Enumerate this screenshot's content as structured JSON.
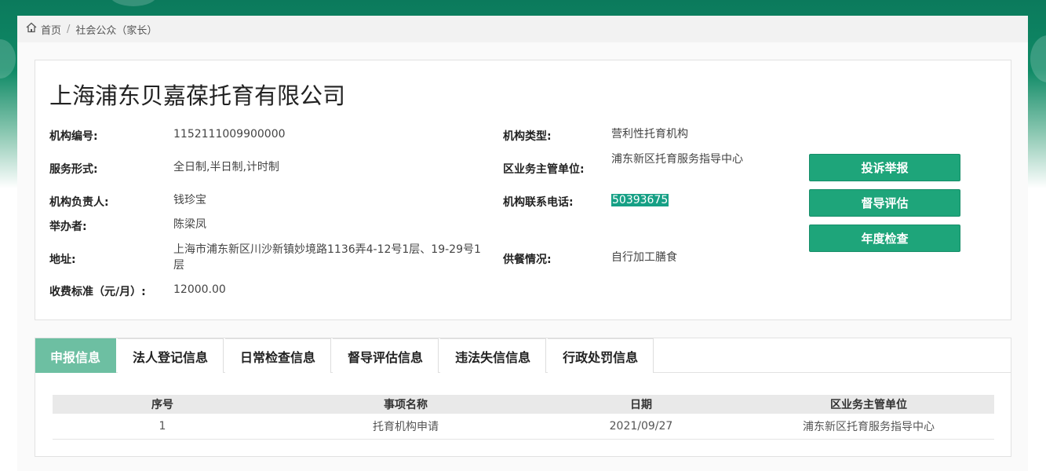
{
  "breadcrumb": {
    "home": "首页",
    "separator": "/",
    "current": "社会公众（家长）"
  },
  "org": {
    "name": "上海浦东贝嘉葆托育有限公司",
    "fields_left": [
      {
        "label": "机构编号:",
        "value": "1152111009900000"
      },
      {
        "label": "服务形式:",
        "value": "全日制,半日制,计时制"
      },
      {
        "label": "机构负责人:",
        "value": "钱珍宝"
      },
      {
        "label": "举办者:",
        "value": "陈梁凤"
      },
      {
        "label": "地址:",
        "value": "上海市浦东新区川沙新镇妙境路1136弄4-12号1层、19-29号1层"
      },
      {
        "label": "收费标准（元/月）:",
        "value": "12000.00"
      }
    ],
    "fields_right": [
      {
        "label": "机构类型:",
        "value": "营利性托育机构"
      },
      {
        "label": "区业务主管单位:",
        "value": "浦东新区托育服务指导中心"
      },
      {
        "label": "机构联系电话:",
        "value": "50393675"
      },
      {
        "label": "供餐情况:",
        "value": "自行加工膳食"
      }
    ]
  },
  "actions": {
    "complaint": "投诉举报",
    "supervision": "督导评估",
    "annual": "年度检查"
  },
  "tabs": [
    {
      "label": "申报信息",
      "active": true
    },
    {
      "label": "法人登记信息",
      "active": false
    },
    {
      "label": "日常检查信息",
      "active": false
    },
    {
      "label": "督导评估信息",
      "active": false
    },
    {
      "label": "违法失信信息",
      "active": false
    },
    {
      "label": "行政处罚信息",
      "active": false
    }
  ],
  "table": {
    "headers": [
      "序号",
      "事项名称",
      "日期",
      "区业务主管单位"
    ],
    "rows": [
      [
        "1",
        "托育机构申请",
        "2021/09/27",
        "浦东新区托育服务指导中心"
      ]
    ]
  },
  "colors": {
    "primary": "#1ea57a",
    "tab_active": "#6dbfa2",
    "header_bg": "#0b7a5c"
  }
}
